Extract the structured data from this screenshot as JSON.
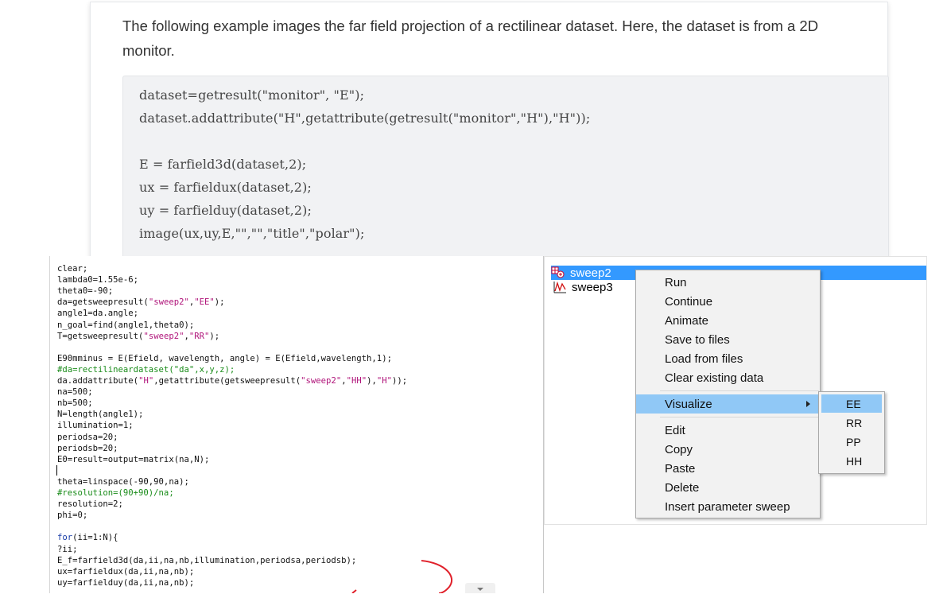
{
  "doc": {
    "text": "The following example images the far field projection of a rectilinear dataset. Here, the dataset is from a 2D monitor.",
    "code": [
      "dataset=getresult(\"monitor\", \"E\");",
      "dataset.addattribute(\"H\",getattribute(getresult(\"monitor\",\"H\"),\"H\"));",
      "",
      "E = farfield3d(dataset,2);",
      "ux = farfieldux(dataset,2);",
      "uy = farfielduy(dataset,2);",
      "image(ux,uy,E,\"\",\"\",\"title\",\"polar\");"
    ]
  },
  "editor": {
    "lines": [
      {
        "text": "clear;",
        "kind": "plain"
      },
      {
        "text": "lambda0=1.55e-6;",
        "kind": "plain"
      },
      {
        "text": "theta0=-90;",
        "kind": "plain"
      },
      {
        "text": "da=getsweepresult(\"sweep2\",\"EE\");",
        "kind": "plain"
      },
      {
        "text": "angle1=da.angle;",
        "kind": "plain"
      },
      {
        "text": "n_goal=find(angle1,theta0);",
        "kind": "plain"
      },
      {
        "text": "T=getsweepresult(\"sweep2\",\"RR\");",
        "kind": "plain"
      },
      {
        "text": "",
        "kind": "plain"
      },
      {
        "text": "E90mminus = E(Efield, wavelength, angle) = E(Efield,wavelength,1);",
        "kind": "plain"
      },
      {
        "text": "#da=rectilineardataset(\"da\",x,y,z);",
        "kind": "comment"
      },
      {
        "text": "da.addattribute(\"H\",getattribute(getsweepresult(\"sweep2\",\"HH\"),\"H\"));",
        "kind": "plain"
      },
      {
        "text": "na=500;",
        "kind": "plain"
      },
      {
        "text": "nb=500;",
        "kind": "plain"
      },
      {
        "text": "N=length(angle1);",
        "kind": "plain"
      },
      {
        "text": "illumination=1;",
        "kind": "plain"
      },
      {
        "text": "periodsa=20;",
        "kind": "plain"
      },
      {
        "text": "periodsb=20;",
        "kind": "plain"
      },
      {
        "text": "E0=result=output=matrix(na,N);",
        "kind": "plain"
      },
      {
        "text": "",
        "kind": "plain"
      },
      {
        "text": "theta=linspace(-90,90,na);",
        "kind": "plain"
      },
      {
        "text": "#resolution=(90+90)/na;",
        "kind": "comment"
      },
      {
        "text": "resolution=2;",
        "kind": "plain"
      },
      {
        "text": "phi=0;",
        "kind": "plain"
      },
      {
        "text": "",
        "kind": "plain"
      },
      {
        "text": "for(ii=1:N){",
        "kind": "plain"
      },
      {
        "text": "?ii;",
        "kind": "plain"
      },
      {
        "text": "E_f=farfield3d(da,ii,na,nb,illumination,periodsa,periodsb);",
        "kind": "plain"
      },
      {
        "text": "ux=farfieldux(da,ii,na,nb);",
        "kind": "plain"
      },
      {
        "text": "uy=farfielduy(da,ii,na,nb);",
        "kind": "plain"
      }
    ]
  },
  "tree": {
    "items": [
      {
        "label": "sweep2",
        "icon": "sweep-grid-icon",
        "selected": true
      },
      {
        "label": "sweep3",
        "icon": "sweep-wave-icon",
        "selected": false
      }
    ]
  },
  "context_menu": {
    "items": [
      "Run",
      "Continue",
      "Animate",
      "Save to files",
      "Load from files",
      "Clear existing data",
      "Visualize",
      "Edit",
      "Copy",
      "Paste",
      "Delete",
      "Insert parameter sweep"
    ],
    "highlighted": "Visualize",
    "submenu": {
      "items": [
        "EE",
        "RR",
        "PP",
        "HH"
      ],
      "highlighted": "EE"
    }
  },
  "colors": {
    "selection": "#3399ff",
    "menu_highlight": "#90c8f6",
    "comment": "#1a8c1a",
    "keyword": "#1a3ea8",
    "string": "#b0147a",
    "annotation": "#e0202a"
  }
}
